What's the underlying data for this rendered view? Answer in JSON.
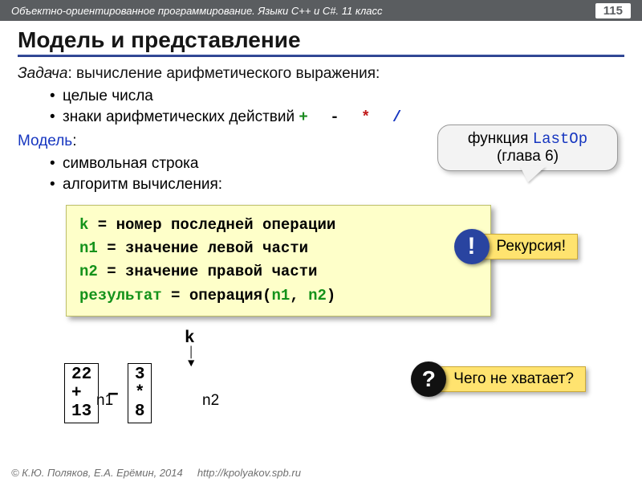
{
  "header": {
    "course": "Объектно-ориентированное программирование. Языки C++ и C#. 11 класс",
    "page": "115"
  },
  "title": "Модель и представление",
  "task": {
    "label": "Задача",
    "text": ": вычисление арифметического выражения:"
  },
  "bullets1": {
    "a": "целые числа",
    "b": "знаки арифметических действий ",
    "ops": {
      "plus": "+",
      "minus": "-",
      "star": "*",
      "slash": "/"
    }
  },
  "model": {
    "label": "Модель",
    "colon": ":"
  },
  "bullets2": {
    "a": "символьная строка",
    "b": "алгоритм вычисления:"
  },
  "callout": {
    "line1a": "функция ",
    "fn": "LastOp",
    "line2": "(глава 6)"
  },
  "code": {
    "l1a": "k",
    "l1b": " = номер последней операции",
    "l2a": "n1",
    "l2b": " = значение левой части",
    "l3a": "n2",
    "l3b": " = значение правой части",
    "l4a": "результат",
    "l4b": " = операция(",
    "l4c": "n1",
    "l4d": ", ",
    "l4e": "n2",
    "l4f": ")"
  },
  "bang": {
    "mark": "!",
    "text": "Рекурсия!"
  },
  "expr": {
    "k": "k",
    "box1": "22 + 13",
    "minus": "–",
    "box2": "3 * 8",
    "n1": "n1",
    "n2": "n2"
  },
  "question": {
    "mark": "?",
    "text": "Чего не хватает?"
  },
  "footer": {
    "copyright": "© К.Ю. Поляков, Е.А. Ерёмин, 2014",
    "url": "http://kpolyakov.spb.ru"
  }
}
